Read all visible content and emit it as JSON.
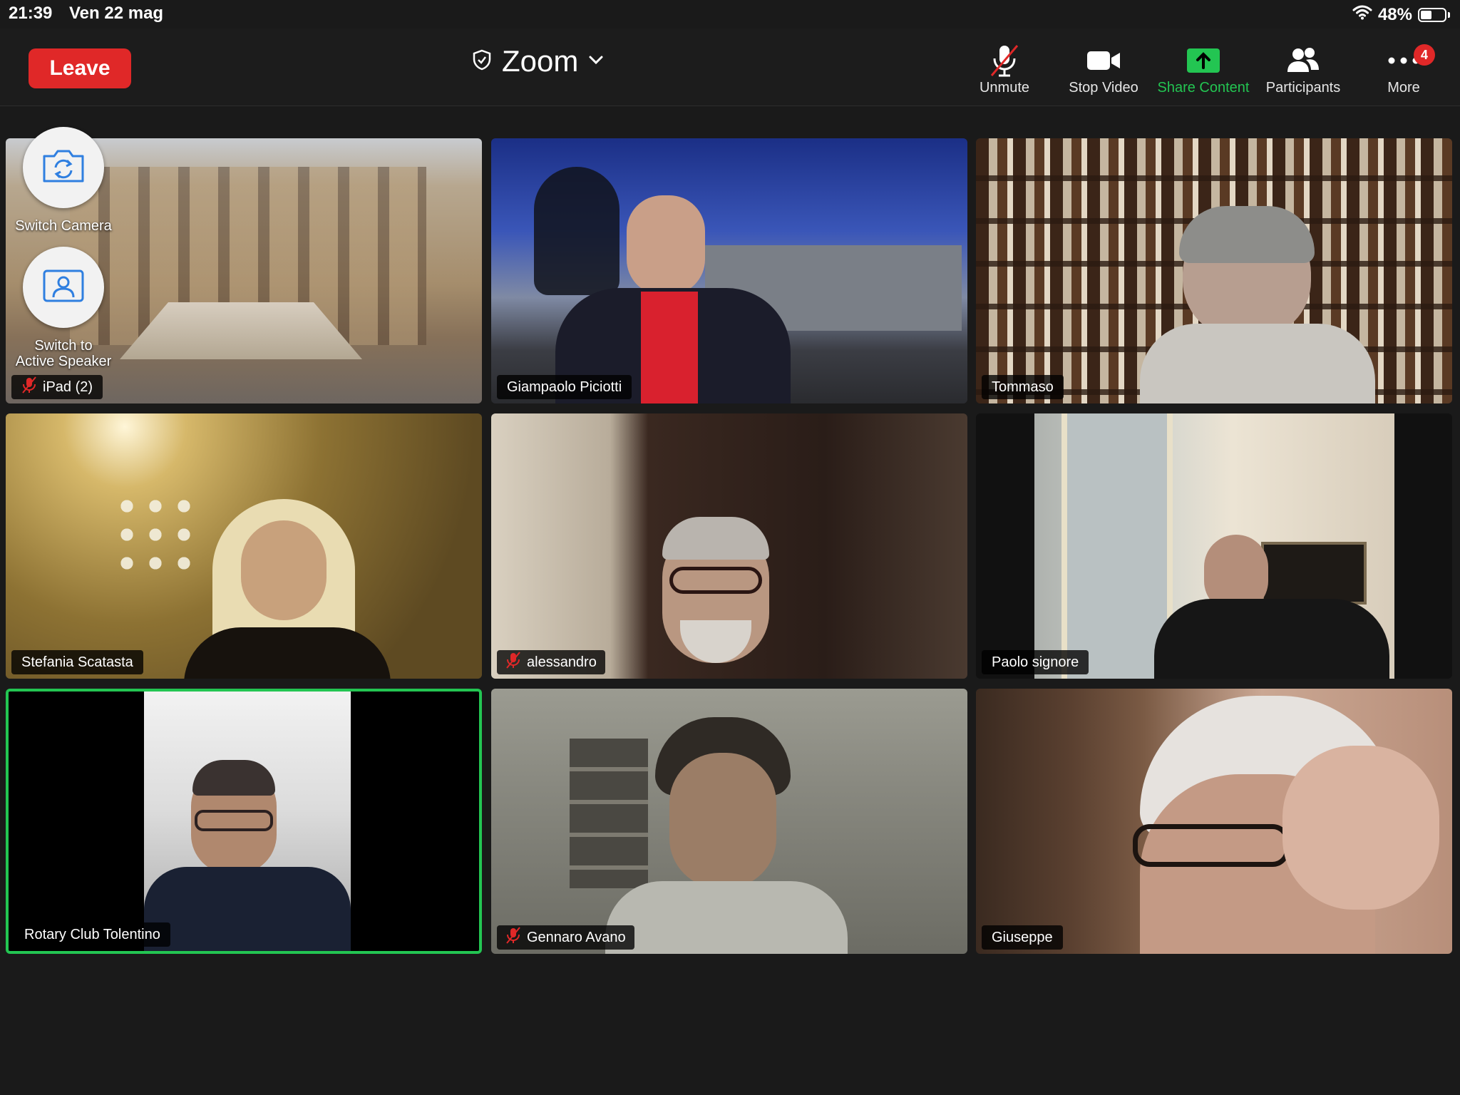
{
  "status_bar": {
    "time": "21:39",
    "date": "Ven 22 mag",
    "battery_percent": "48%",
    "battery_level": 0.48
  },
  "toolbar": {
    "leave_label": "Leave",
    "meeting_title": "Zoom",
    "unmute_label": "Unmute",
    "stop_video_label": "Stop Video",
    "share_content_label": "Share Content",
    "participants_label": "Participants",
    "more_label": "More",
    "more_badge": "4"
  },
  "overlay": {
    "switch_camera_label": "Switch Camera",
    "switch_speaker_label_line1": "Switch to",
    "switch_speaker_label_line2": "Active Speaker"
  },
  "tiles": [
    {
      "name": "iPad (2)",
      "muted": true
    },
    {
      "name": "Giampaolo Piciotti",
      "muted": false
    },
    {
      "name": "Tommaso",
      "muted": false
    },
    {
      "name": "Stefania Scatasta",
      "muted": false
    },
    {
      "name": "alessandro",
      "muted": true
    },
    {
      "name": "Paolo signore",
      "muted": false
    },
    {
      "name": "Rotary Club Tolentino",
      "muted": false,
      "active_speaker": true
    },
    {
      "name": "Gennaro Avano",
      "muted": true
    },
    {
      "name": "Giuseppe",
      "muted": false
    }
  ],
  "colors": {
    "leave": "#e02828",
    "share_green": "#23c552",
    "active_border": "#23c552",
    "background": "#1a1a1a"
  }
}
